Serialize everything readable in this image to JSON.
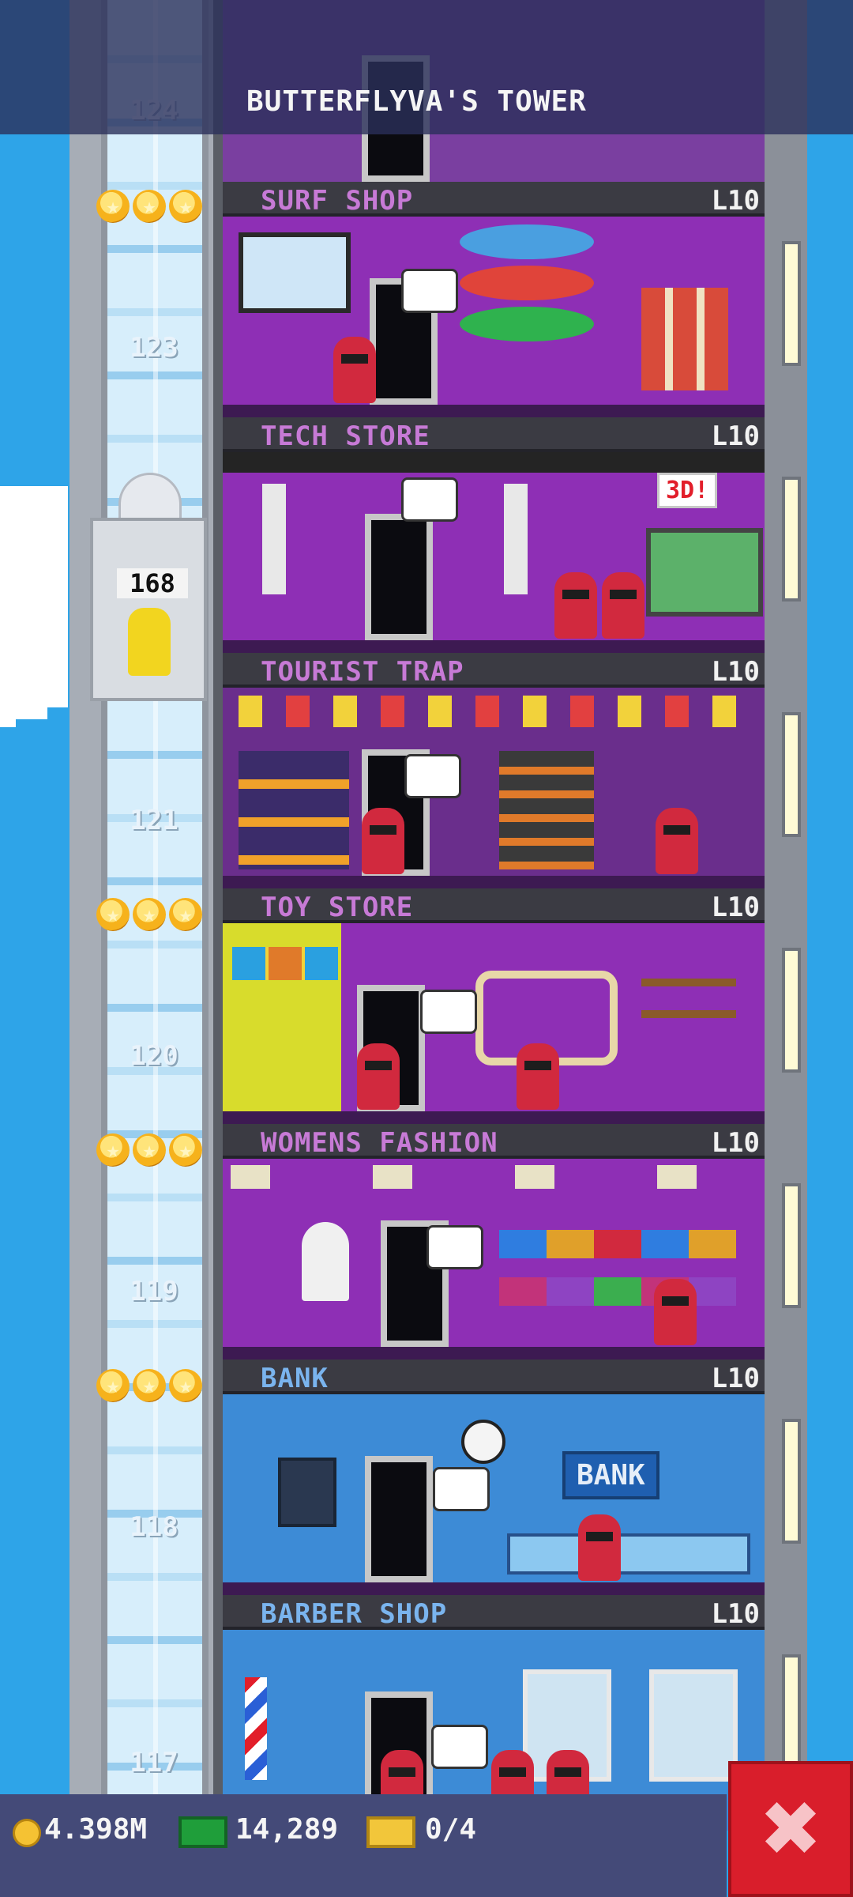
{
  "header": {
    "tower_name": "BUTTERFLYVA'S TOWER"
  },
  "elevator": {
    "passenger_count": "168",
    "floor_numbers": [
      "124",
      "123",
      "121",
      "120",
      "119",
      "118",
      "117"
    ]
  },
  "floors": [
    {
      "name": "SURF SHOP",
      "level": "L10",
      "room": "purple"
    },
    {
      "name": "TECH STORE",
      "level": "L10",
      "room": "purple"
    },
    {
      "name": "TOURIST TRAP",
      "level": "L10",
      "room": "purple"
    },
    {
      "name": "TOY STORE",
      "level": "L10",
      "room": "purple"
    },
    {
      "name": "WOMENS FASHION",
      "level": "L10",
      "room": "purple"
    },
    {
      "name": "BANK",
      "level": "L10",
      "room": "blue"
    },
    {
      "name": "BARBER SHOP",
      "level": "L10",
      "room": "blue"
    }
  ],
  "signs": {
    "tech_3d": "3D!",
    "bank": "BANK"
  },
  "status_bar": {
    "coins": "4.398M",
    "bux": "14,289",
    "tickets": "0/4"
  },
  "buttons": {
    "close": "✖"
  },
  "colors": {
    "sky": "#2ea4e8",
    "retail_label": "#c77ad6",
    "service_label": "#7ab4ee",
    "close_button": "#d91e2b"
  }
}
